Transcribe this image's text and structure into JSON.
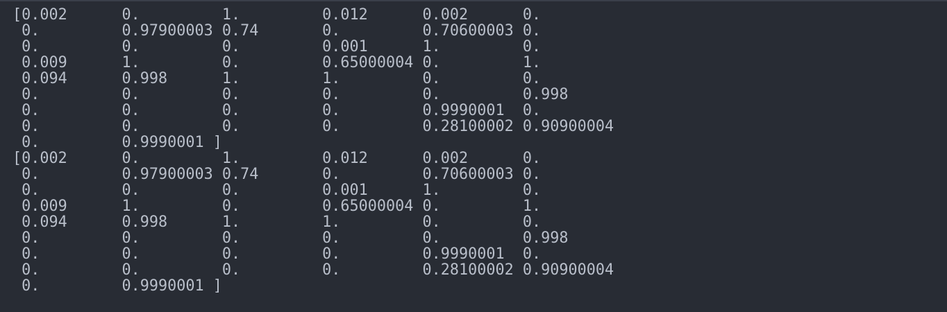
{
  "terminal": {
    "lines": [
      "[0.002      0.         1.         0.012      0.002      0.",
      " 0.         0.97900003 0.74       0.         0.70600003 0.",
      " 0.         0.         0.         0.001      1.         0.",
      " 0.009      1.         0.         0.65000004 0.         1.",
      " 0.094      0.998      1.         1.         0.         0.",
      " 0.         0.         0.         0.         0.         0.998",
      " 0.         0.         0.         0.         0.9990001  0.",
      " 0.         0.         0.         0.         0.28100002 0.90900004",
      " 0.         0.9990001 ]",
      "[0.002      0.         1.         0.012      0.002      0.",
      " 0.         0.97900003 0.74       0.         0.70600003 0.",
      " 0.         0.         0.         0.001      1.         0.",
      " 0.009      1.         0.         0.65000004 0.         1.",
      " 0.094      0.998      1.         1.         0.         0.",
      " 0.         0.         0.         0.         0.         0.998",
      " 0.         0.         0.         0.         0.9990001  0.",
      " 0.         0.         0.         0.         0.28100002 0.90900004",
      " 0.         0.9990001 ]"
    ]
  }
}
